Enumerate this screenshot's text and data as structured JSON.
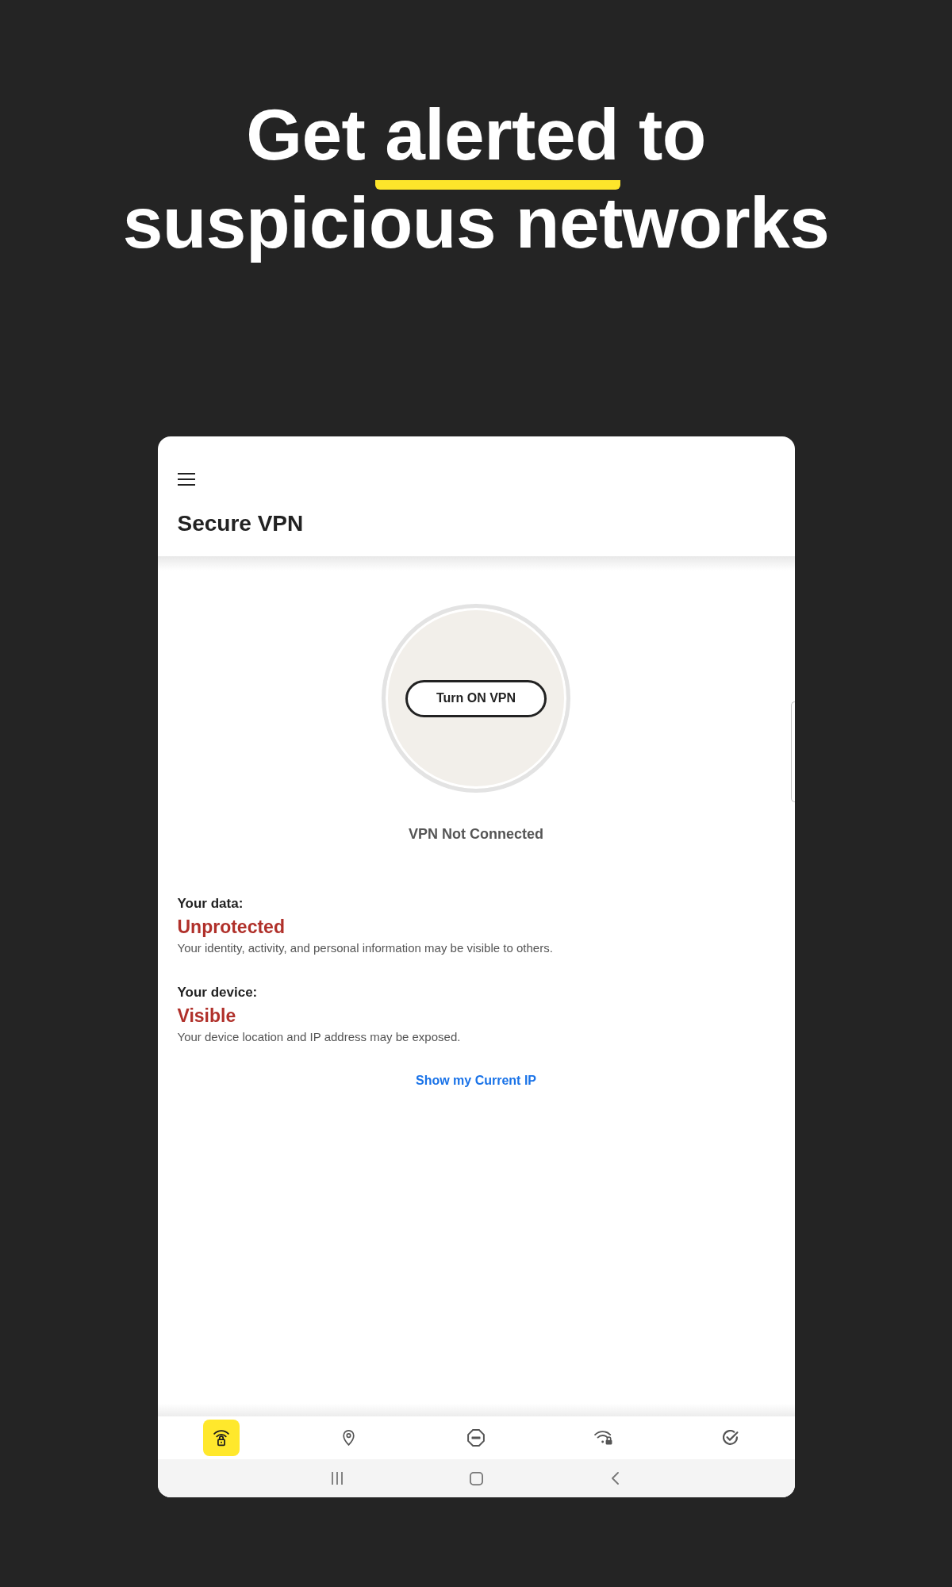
{
  "headline": {
    "lines": [
      {
        "segments": [
          {
            "text": "Get ",
            "underlined": false
          },
          {
            "text": "alerted",
            "underlined": true
          },
          {
            "text": " to",
            "underlined": false
          }
        ]
      },
      {
        "segments": [
          {
            "text": "suspicious networks",
            "underlined": false
          }
        ]
      }
    ]
  },
  "app": {
    "title": "Secure VPN",
    "vpn_button": "Turn ON VPN",
    "connection_status": "VPN Not Connected",
    "status_items": [
      {
        "label": "Your data:",
        "value": "Unprotected",
        "description": "Your identity, activity, and personal information may be visible to others."
      },
      {
        "label": "Your device:",
        "value": "Visible",
        "description": "Your device location and IP address may be exposed."
      }
    ],
    "link": "Show my Current IP",
    "bottom_nav": [
      {
        "kind": "vpn",
        "selected": true
      },
      {
        "kind": "location",
        "selected": false
      },
      {
        "kind": "block",
        "selected": false
      },
      {
        "kind": "wifi_lock",
        "selected": false
      },
      {
        "kind": "check",
        "selected": false
      }
    ]
  }
}
